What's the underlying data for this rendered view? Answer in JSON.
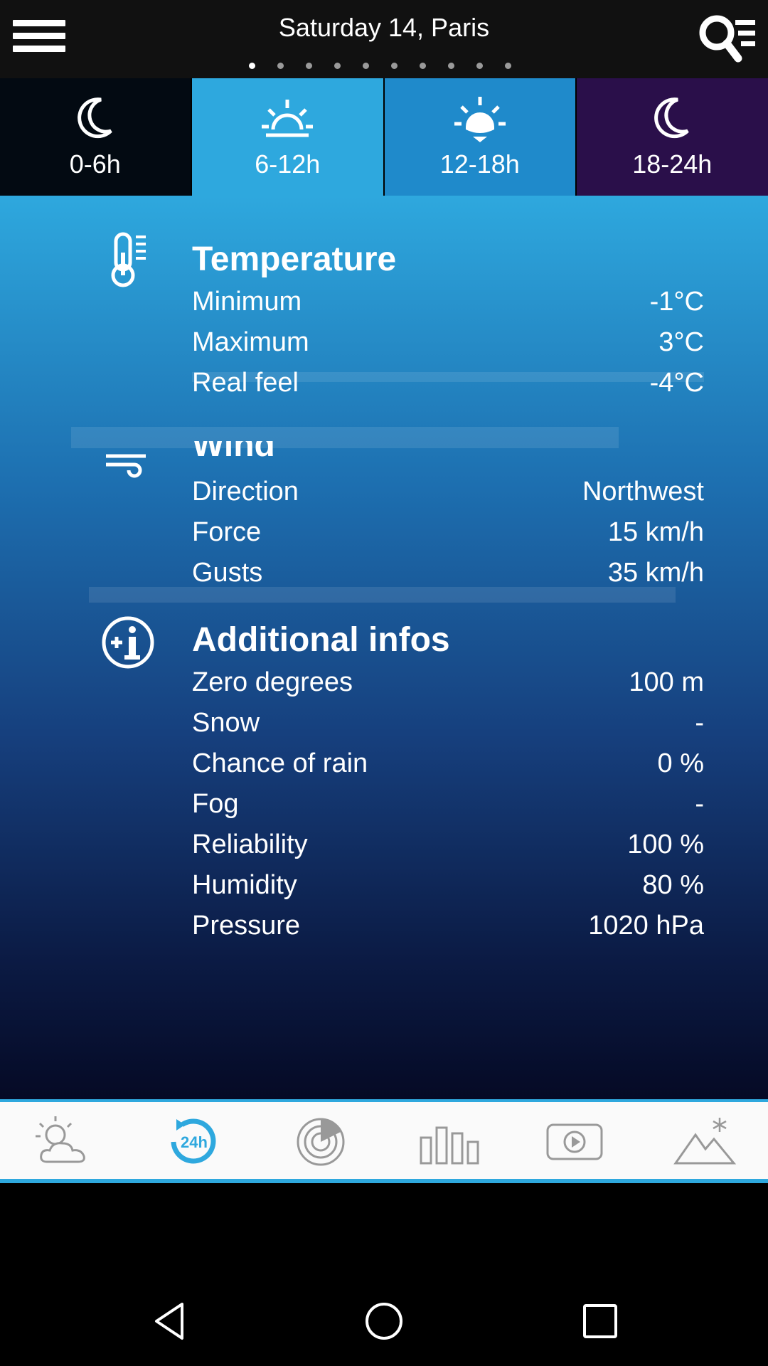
{
  "header": {
    "title": "Saturday 14, Paris",
    "page_count": 10,
    "active_page": 1
  },
  "tabs": [
    {
      "label": "0-6h",
      "icon": "moon-icon"
    },
    {
      "label": "6-12h",
      "icon": "sunrise-icon"
    },
    {
      "label": "12-18h",
      "icon": "sun-icon"
    },
    {
      "label": "18-24h",
      "icon": "moon-icon"
    }
  ],
  "temperature": {
    "title": "Temperature",
    "rows": [
      {
        "label": "Minimum",
        "value": "-1°C"
      },
      {
        "label": "Maximum",
        "value": "3°C"
      },
      {
        "label": "Real feel",
        "value": "-4°C"
      }
    ]
  },
  "wind": {
    "title": "Wind",
    "rows": [
      {
        "label": "Direction",
        "value": "Northwest"
      },
      {
        "label": "Force",
        "value": "15 km/h"
      },
      {
        "label": "Gusts",
        "value": "35 km/h"
      }
    ]
  },
  "additional": {
    "title": "Additional infos",
    "rows": [
      {
        "label": "Zero degrees",
        "value": "100 m"
      },
      {
        "label": "Snow",
        "value": "-"
      },
      {
        "label": "Chance of rain",
        "value": "0 %"
      },
      {
        "label": "Fog",
        "value": "-"
      },
      {
        "label": "Reliability",
        "value": "100 %"
      },
      {
        "label": "Humidity",
        "value": "80 %"
      },
      {
        "label": "Pressure",
        "value": "1020 hPa"
      }
    ]
  },
  "bottom_nav": {
    "items": [
      "weather-icon",
      "24h-forecast-icon",
      "radar-icon",
      "chart-icon",
      "video-icon",
      "mountain-icon"
    ],
    "active": "24h-forecast-icon",
    "accent": "#2ea8de"
  },
  "colors": {
    "accent": "#2ea8de",
    "tab_active": "#2ea8de",
    "tab_day": "#1f8acb",
    "tab_night_late": "#2a0f4a"
  }
}
